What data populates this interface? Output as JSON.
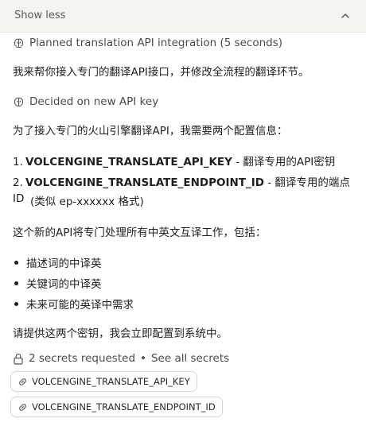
{
  "header": {
    "toggle_label": "Show less"
  },
  "steps": [
    {
      "label": "Planned translation API integration (5 seconds)"
    },
    {
      "label": "Decided on new API key"
    }
  ],
  "messages": {
    "intro": "我来帮你接入专门的翻译API接口，并修改全流程的翻译环节。",
    "config_intro": "为了接入专门的火山引擎翻译API，我需要两个配置信息：",
    "list": [
      {
        "num": "1.",
        "key": "VOLCENGINE_TRANSLATE_API_KEY",
        "desc": " - 翻译专用的API密钥"
      },
      {
        "num": "2.",
        "key": "VOLCENGINE_TRANSLATE_ENDPOINT_ID",
        "desc": " - 翻译专用的端点ID",
        "desc2": "(类似 ep-xxxxxx 格式)"
      }
    ],
    "usage_intro": "这个新的API将专门处理所有中英文互译工作，包括：",
    "bullets": [
      "描述词的中译英",
      "关键词的中译英",
      "未来可能的英译中需求"
    ],
    "closing": "请提供这两个密钥，我会立即配置到系统中。"
  },
  "secrets": {
    "count_text": "2 secrets requested",
    "separator": "•",
    "see_all": "See all secrets",
    "items": [
      "VOLCENGINE_TRANSLATE_API_KEY",
      "VOLCENGINE_TRANSLATE_ENDPOINT_ID"
    ]
  },
  "icons": {
    "chevron": "chevron-up-icon",
    "brain": "brain-icon",
    "lock": "lock-icon",
    "link": "link-icon"
  }
}
